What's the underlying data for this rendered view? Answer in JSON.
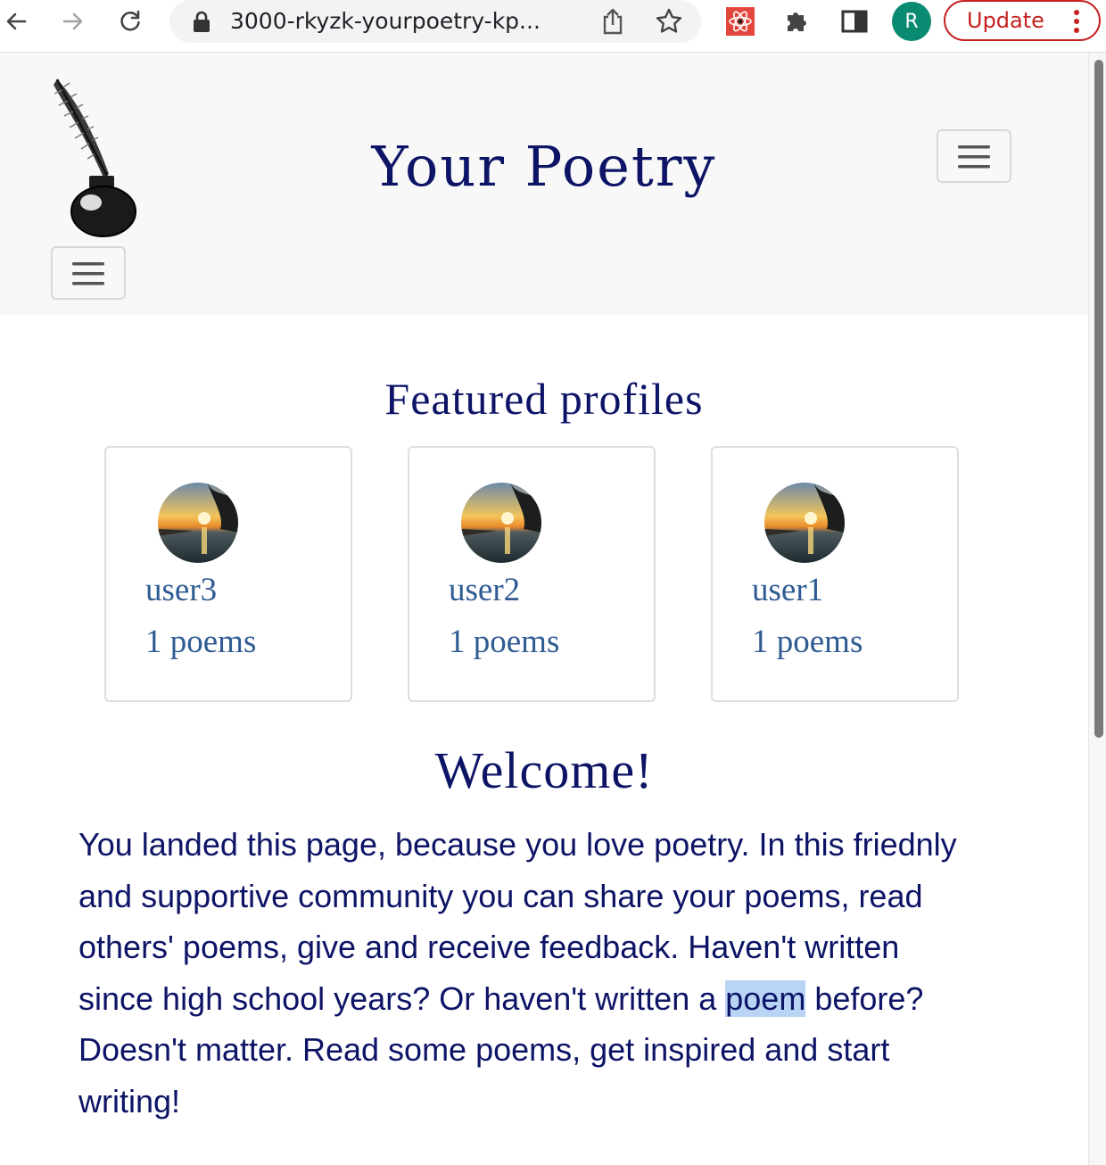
{
  "browser": {
    "url": "3000-rkyzk-yourpoetry-kp...",
    "profile_initial": "R",
    "update_label": "Update",
    "icons": [
      "back-arrow-icon",
      "forward-arrow-icon",
      "reload-icon",
      "lock-icon",
      "share-icon",
      "star-icon",
      "react-devtools-icon",
      "puzzle-extensions-icon",
      "side-panel-icon",
      "more-vert-icon"
    ]
  },
  "header": {
    "title": "Your Poetry",
    "logo_icon": "quill-inkwell-logo"
  },
  "featured": {
    "heading": "Featured profiles",
    "profiles": [
      {
        "username": "user3",
        "poem_count": "1 poems"
      },
      {
        "username": "user2",
        "poem_count": "1 poems"
      },
      {
        "username": "user1",
        "poem_count": "1 poems"
      }
    ]
  },
  "welcome": {
    "heading": "Welcome!",
    "text_before": "You landed this page, because you love poetry. In this friednly and supportive community you can share your poems, read others' poems, give and receive feedback. Haven't written since high school years? Or haven't written a ",
    "highlighted": "poem",
    "text_after": " before? Doesn't matter. Read some poems, get inspired and start writing!"
  },
  "colors": {
    "brand_navy": "#0d1466",
    "link_blue": "#2f5b93",
    "header_bg": "#f8f8f8",
    "selection": "#b9d4f5",
    "update_red": "#c5221f",
    "avatar_green": "#0b8a72"
  }
}
